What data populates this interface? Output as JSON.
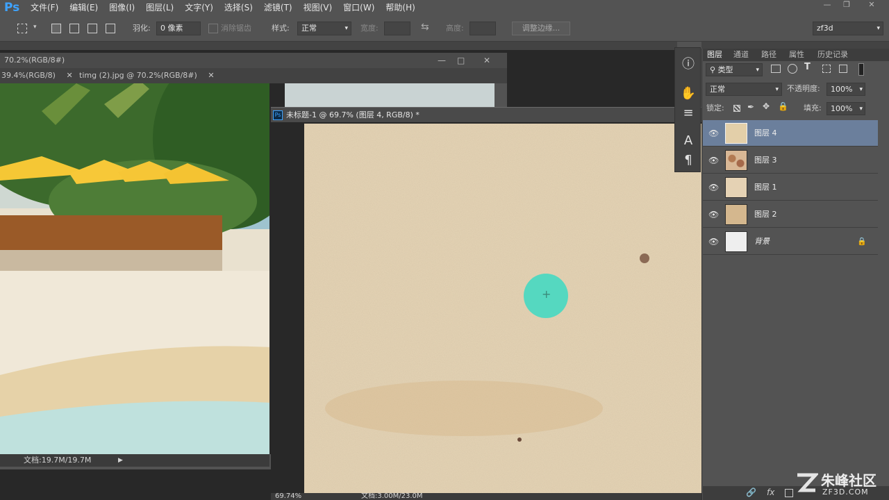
{
  "menubar": {
    "logo": "Ps",
    "items": [
      "文件(F)",
      "编辑(E)",
      "图像(I)",
      "图层(L)",
      "文字(Y)",
      "选择(S)",
      "滤镜(T)",
      "视图(V)",
      "窗口(W)",
      "帮助(H)"
    ]
  },
  "options": {
    "feather_label": "羽化:",
    "feather_value": "0 像素",
    "antialias_label": "消除锯齿",
    "style_label": "样式:",
    "style_value": "正常",
    "width_label": "宽度:",
    "height_label": "高度:",
    "refine_button": "调整边缘...",
    "workspace_value": "zf3d"
  },
  "doc1": {
    "title": "70.2%(RGB/8#)",
    "tab1": "39.4%(RGB/8)",
    "tab2": "timg (2).jpg @ 70.2%(RGB/8#)",
    "status": "文档:19.7M/19.7M"
  },
  "doc2": {
    "title": "未标题-1 @ 69.7% (图层 4, RGB/8) *",
    "status_zoom": "69.74%",
    "status_doc": "文档:3.00M/23.0M"
  },
  "panel": {
    "tabs": [
      "图层",
      "通道",
      "路径",
      "属性",
      "历史记录"
    ],
    "filter_label": "类型",
    "blend_mode": "正常",
    "opacity_label": "不透明度:",
    "opacity_value": "100%",
    "lock_label": "锁定:",
    "fill_label": "填充:",
    "fill_value": "100%",
    "layers": [
      {
        "name": "图层 4",
        "selected": true
      },
      {
        "name": "图层 3",
        "selected": false
      },
      {
        "name": "图层 1",
        "selected": false
      },
      {
        "name": "图层 2",
        "selected": false
      },
      {
        "name": "背景",
        "selected": false
      }
    ]
  },
  "watermark": {
    "text": "朱峰社区",
    "url": "ZF3D.COM"
  },
  "colors": {
    "brush_cursor": "#55d8c0",
    "selected_layer": "#6b7f9c",
    "ps_logo": "#3ea3ff"
  }
}
